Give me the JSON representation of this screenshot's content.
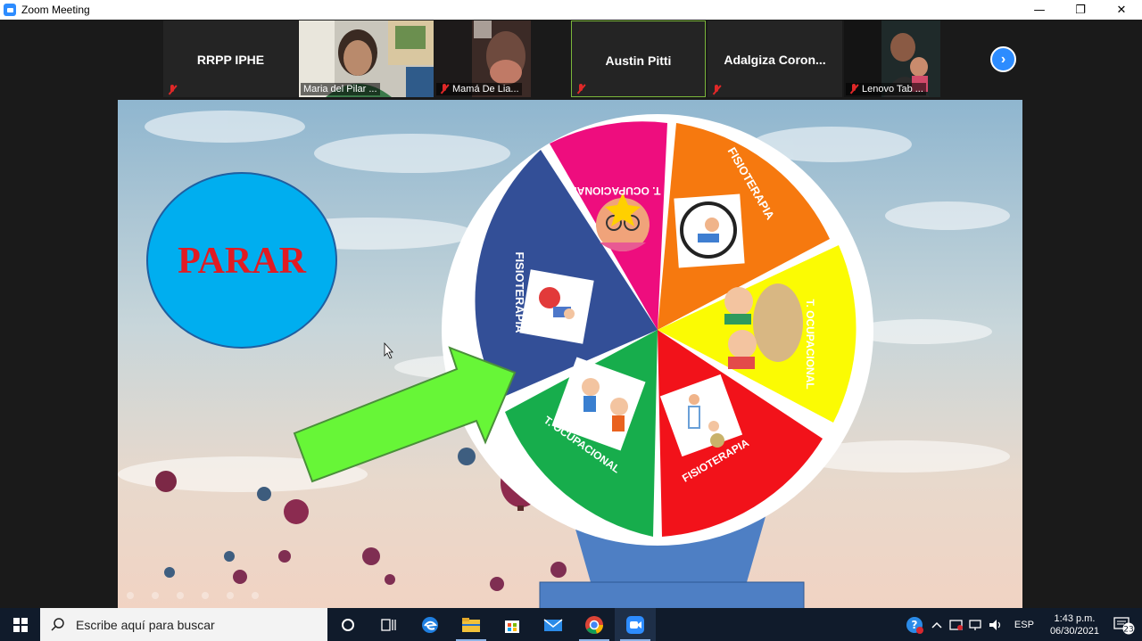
{
  "window": {
    "title": "Zoom Meeting",
    "minimize": "—",
    "restore": "❐",
    "close": "✕"
  },
  "participants": [
    {
      "name": "RRPP IPHE",
      "display": "name",
      "muted": true
    },
    {
      "name": "Maria del Pilar ...",
      "display": "video",
      "muted": false
    },
    {
      "name": "Mamá De Lia...",
      "display": "video",
      "muted": true
    },
    {
      "name": "Austin Pitti",
      "display": "name",
      "muted": true,
      "active": true
    },
    {
      "name": "Adalgiza  Coron...",
      "display": "name",
      "muted": true
    },
    {
      "name": "Lenovo Tab ...",
      "display": "video",
      "muted": true
    }
  ],
  "next_button": "›",
  "slide": {
    "stop_button": "PARAR",
    "wheel": [
      {
        "label": "T. OCUPACIONAL",
        "color": "#ee0d7e"
      },
      {
        "label": "FISIOTERAPIA",
        "color": "#f6790f"
      },
      {
        "label": "T. OCUPACIONAL",
        "color": "#fbfb03"
      },
      {
        "label": "FISIOTERAPIA",
        "color": "#f2121a"
      },
      {
        "label": "T. OCUPACIONAL",
        "color": "#17ad4c"
      },
      {
        "label": "FISIOTERAPIA",
        "color": "#334f97"
      }
    ],
    "arrow_color": "#67f637",
    "circle_color": "#00aeef",
    "stop_text_color": "#e11b22"
  },
  "taskbar": {
    "search_placeholder": "Escribe aquí para buscar",
    "language": "ESP",
    "time": "1:43 p.m.",
    "date": "06/30/2021",
    "notifications": "23"
  }
}
